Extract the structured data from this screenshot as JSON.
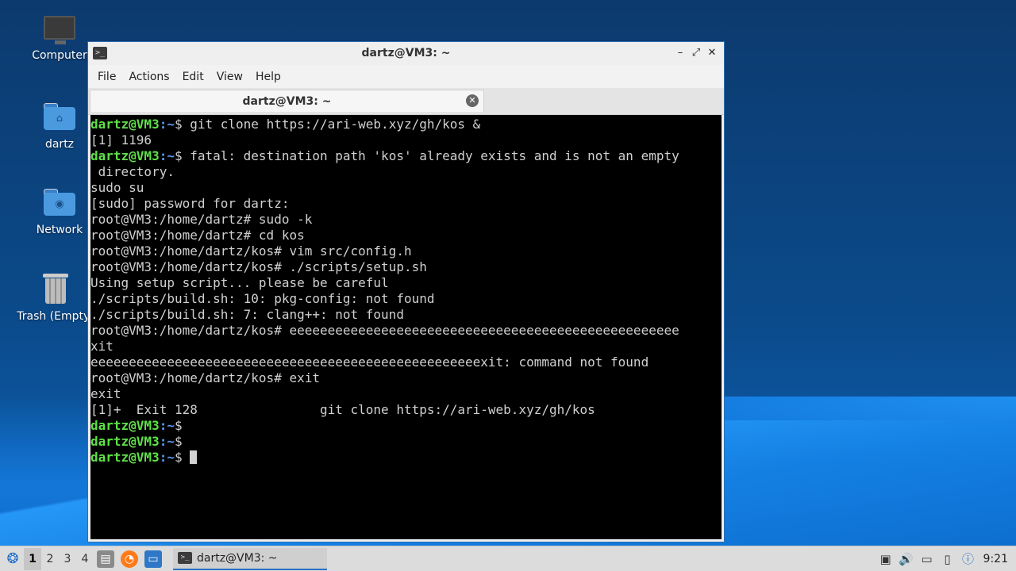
{
  "desktop": {
    "icons": [
      {
        "label": "Computer"
      },
      {
        "label": "dartz"
      },
      {
        "label": "Network"
      },
      {
        "label": "Trash (Empty)"
      }
    ]
  },
  "window": {
    "title": "dartz@VM3: ~",
    "menu": [
      "File",
      "Actions",
      "Edit",
      "View",
      "Help"
    ],
    "tab_title": "dartz@VM3: ~"
  },
  "terminal": {
    "prompt_user": "dartz@VM3",
    "prompt_path": ":~",
    "lines": [
      {
        "type": "prompt",
        "cmd": "$ git clone https://ari-web.xyz/gh/kos &"
      },
      {
        "type": "out",
        "text": "[1] 1196"
      },
      {
        "type": "prompt",
        "cmd": "$ fatal: destination path 'kos' already exists and is not an empty"
      },
      {
        "type": "out",
        "text": " directory."
      },
      {
        "type": "out",
        "text": "sudo su"
      },
      {
        "type": "out",
        "text": "[sudo] password for dartz:"
      },
      {
        "type": "out",
        "text": "root@VM3:/home/dartz# sudo -k"
      },
      {
        "type": "out",
        "text": "root@VM3:/home/dartz# cd kos"
      },
      {
        "type": "out",
        "text": "root@VM3:/home/dartz/kos# vim src/config.h"
      },
      {
        "type": "out",
        "text": "root@VM3:/home/dartz/kos# ./scripts/setup.sh"
      },
      {
        "type": "out",
        "text": "Using setup script... please be careful"
      },
      {
        "type": "out",
        "text": "./scripts/build.sh: 10: pkg-config: not found"
      },
      {
        "type": "out",
        "text": "./scripts/build.sh: 7: clang++: not found"
      },
      {
        "type": "out",
        "text": "root@VM3:/home/dartz/kos# eeeeeeeeeeeeeeeeeeeeeeeeeeeeeeeeeeeeeeeeeeeeeeeeeee"
      },
      {
        "type": "out",
        "text": "xit"
      },
      {
        "type": "out",
        "text": "eeeeeeeeeeeeeeeeeeeeeeeeeeeeeeeeeeeeeeeeeeeeeeeeeeexit: command not found"
      },
      {
        "type": "out",
        "text": "root@VM3:/home/dartz/kos# exit"
      },
      {
        "type": "out",
        "text": "exit"
      },
      {
        "type": "out",
        "text": "[1]+  Exit 128                git clone https://ari-web.xyz/gh/kos"
      },
      {
        "type": "prompt",
        "cmd": "$"
      },
      {
        "type": "prompt",
        "cmd": "$"
      },
      {
        "type": "prompt",
        "cmd": "$ ",
        "cursor": true
      }
    ]
  },
  "taskbar": {
    "workspaces": [
      "1",
      "2",
      "3",
      "4"
    ],
    "task_label": "dartz@VM3: ~",
    "clock": "9:21"
  }
}
